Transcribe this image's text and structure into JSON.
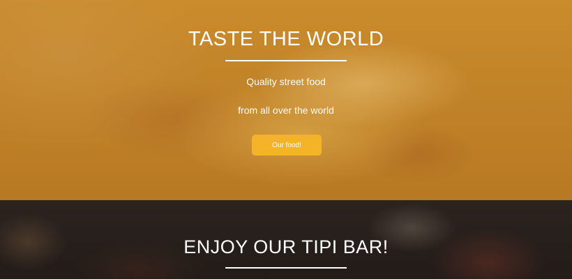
{
  "hero": {
    "title": "TASTE THE WORLD",
    "tagline_line1": "Quality street food",
    "tagline_line2": "from all over the world",
    "cta_label": "Our food!",
    "overlay_color": "#d69628",
    "cta_color": "#f5b327"
  },
  "bar": {
    "title": "ENJOY OUR TIPI BAR!"
  }
}
